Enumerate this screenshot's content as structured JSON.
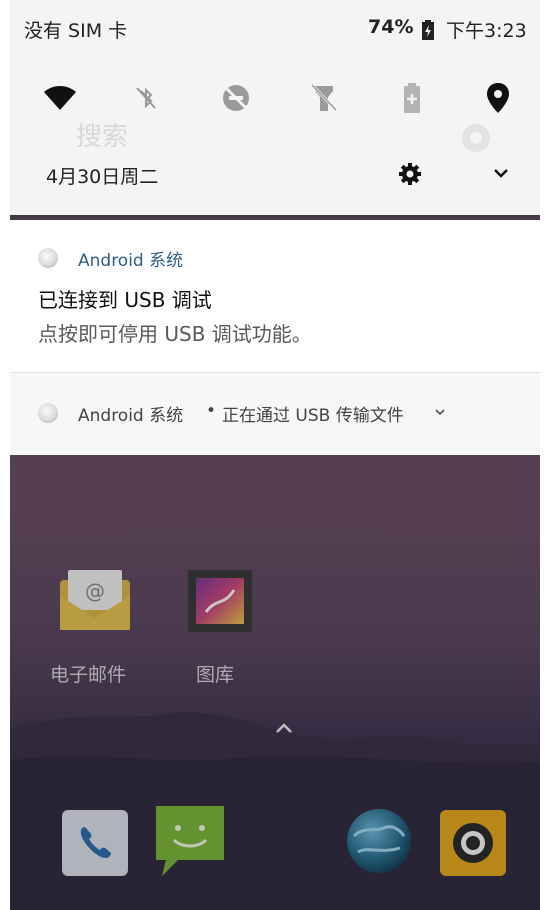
{
  "status_bar": {
    "carrier": "没有 SIM 卡",
    "battery": "74%",
    "time": "下午3:23"
  },
  "quick_settings": {
    "ghost_search": "搜索",
    "date": "4月30日周二",
    "tiles": [
      "wifi-icon",
      "bluetooth-off-icon",
      "dnd-off-icon",
      "flashlight-off-icon",
      "battery-saver-icon",
      "location-icon"
    ]
  },
  "notifications": [
    {
      "app": "Android 系统",
      "title": "已连接到 USB 调试",
      "text": "点按即可停用 USB 调试功能。"
    },
    {
      "app": "Android 系统",
      "separator": "•",
      "summary": "正在通过 USB 传输文件"
    }
  ],
  "home": {
    "apps": [
      {
        "label": "电子邮件"
      },
      {
        "label": "图库"
      }
    ],
    "dock": [
      "phone-icon",
      "messaging-icon",
      "browser-icon",
      "camera-icon"
    ]
  }
}
